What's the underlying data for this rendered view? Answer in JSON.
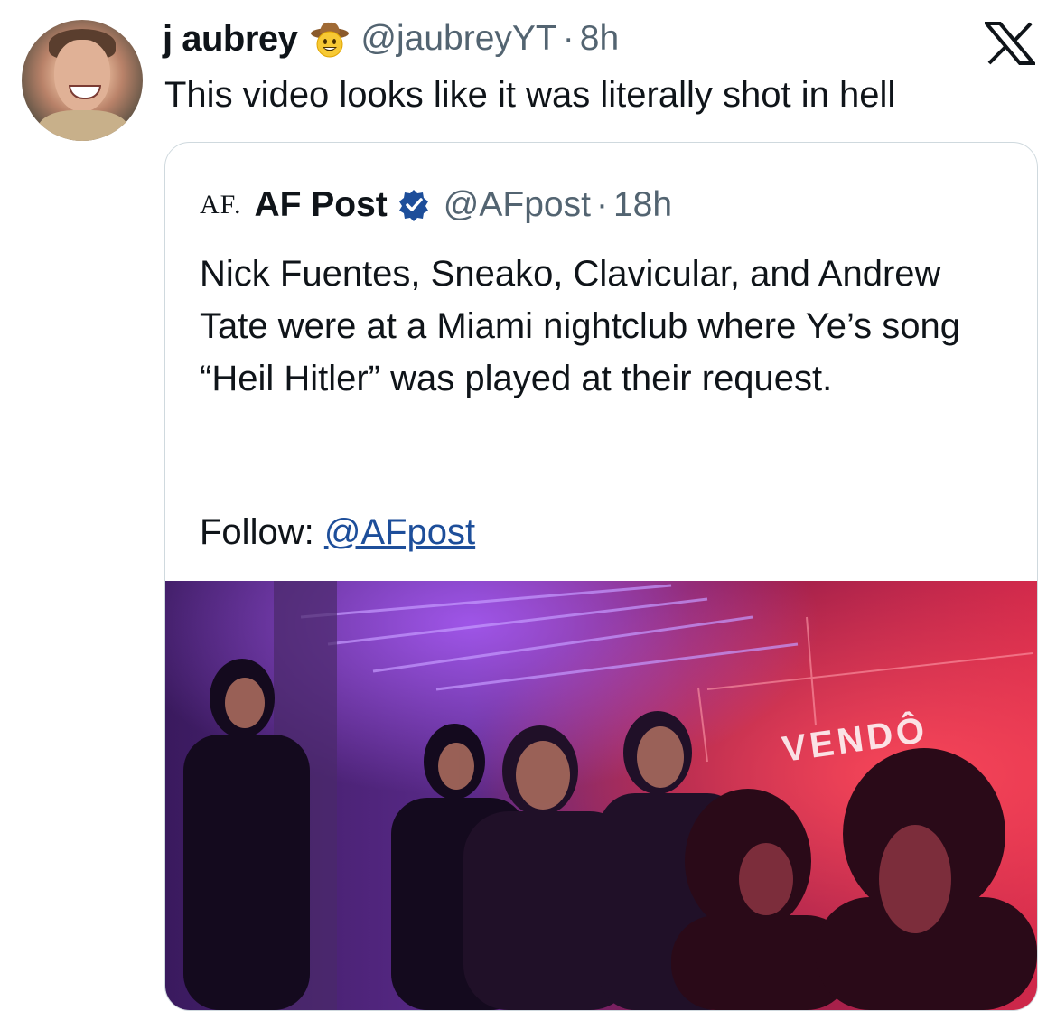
{
  "tweet": {
    "author_name": "j aubrey",
    "author_emoji": "cowboy-face-emoji",
    "handle": "@jaubreyYT",
    "separator": "·",
    "time": "8h",
    "text": "This video looks like it was literally shot in hell"
  },
  "platform_logo": "x-logo",
  "quoted_tweet": {
    "logo_text": "AF.",
    "author_name": "AF Post",
    "verified": true,
    "handle": "@AFpost",
    "separator": "·",
    "time": "18h",
    "text": "Nick Fuentes, Sneako, Clavicular, and Andrew Tate were at a Miami nightclub where Ye’s song “Heil Hitler” was played at their request.",
    "follow_label": "Follow:",
    "follow_link": "@AFpost",
    "media_sign_text": "VENDÔ"
  },
  "colors": {
    "text": "#0f1419",
    "secondary": "#536471",
    "link": "#1d4e9a",
    "verified": "#1d4e9a",
    "border": "#cfd9de"
  }
}
